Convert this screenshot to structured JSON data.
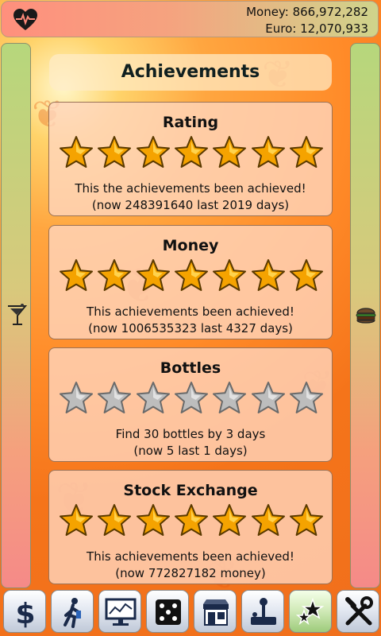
{
  "header": {
    "money_label": "Money: 866,972,282",
    "euro_label": "Euro: 12,070,933",
    "health_icon": "heart-pulse-icon"
  },
  "side": {
    "left_icon": "cocktail-glass-icon",
    "right_icon": "burger-icon"
  },
  "page_title": "Achievements",
  "achievements": [
    {
      "title": "Rating",
      "stars_filled": 7,
      "stars_total": 7,
      "line1": "This the achievements been achieved!",
      "line2": "(now 248391640 last 2019 days)"
    },
    {
      "title": "Money",
      "stars_filled": 7,
      "stars_total": 7,
      "line1": "This achievements been achieved!",
      "line2": "(now 1006535323 last 4327 days)"
    },
    {
      "title": "Bottles",
      "stars_filled": 0,
      "stars_total": 7,
      "line1": "Find 30 bottles by 3 days",
      "line2": "(now 5 last 1 days)"
    },
    {
      "title": "Stock Exchange",
      "stars_filled": 7,
      "stars_total": 7,
      "line1": "This achievements been achieved!",
      "line2": "(now 772827182 money)"
    }
  ],
  "toolbar": [
    {
      "name": "dollar-icon"
    },
    {
      "name": "walking-man-icon"
    },
    {
      "name": "stock-monitor-icon"
    },
    {
      "name": "dice-icon"
    },
    {
      "name": "shop-icon"
    },
    {
      "name": "joystick-icon"
    },
    {
      "name": "achievement-stars-icon",
      "active": true
    },
    {
      "name": "tools-icon"
    }
  ],
  "colors": {
    "star_gold": "#f5a300",
    "star_gray": "#bdbdbd",
    "background_orange": "#f5741a"
  }
}
